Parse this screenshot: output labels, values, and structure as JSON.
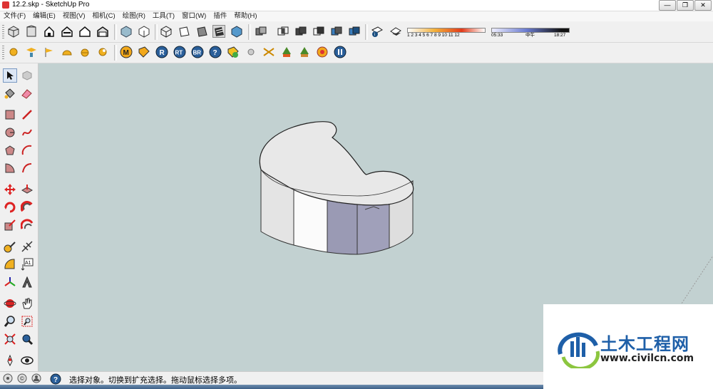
{
  "window": {
    "title": "12.2.skp - SketchUp Pro",
    "minimize": "—",
    "restore": "❐",
    "close": "✕"
  },
  "menu": [
    "文件(F)",
    "编辑(E)",
    "视图(V)",
    "相机(C)",
    "绘图(R)",
    "工具(T)",
    "窗口(W)",
    "插件",
    "帮助(H)"
  ],
  "toolbar2_labels": {
    "m": "M",
    "r": "R",
    "rt": "RT",
    "br": "BR",
    "help": "?"
  },
  "shadows": {
    "date_ticks": "1  2  3  4  5  6  7  8  9  10 11 12",
    "time_start": "05:33",
    "time_mid": "中午",
    "time_end": "18:27"
  },
  "tools": {
    "text_tool_label": "A1"
  },
  "status": {
    "message": "选择对象。切换到扩充选择。拖动鼠标选择多项。"
  },
  "watermark": {
    "name": "土木工程网",
    "url": "www.civilcn.com"
  },
  "colors": {
    "viewport_bg": "#c2d1d1",
    "model_top": "#e8e8e8",
    "model_side": "#dadada",
    "model_selected": "#9a9ab4",
    "brand_blue": "#1e5fa8"
  }
}
